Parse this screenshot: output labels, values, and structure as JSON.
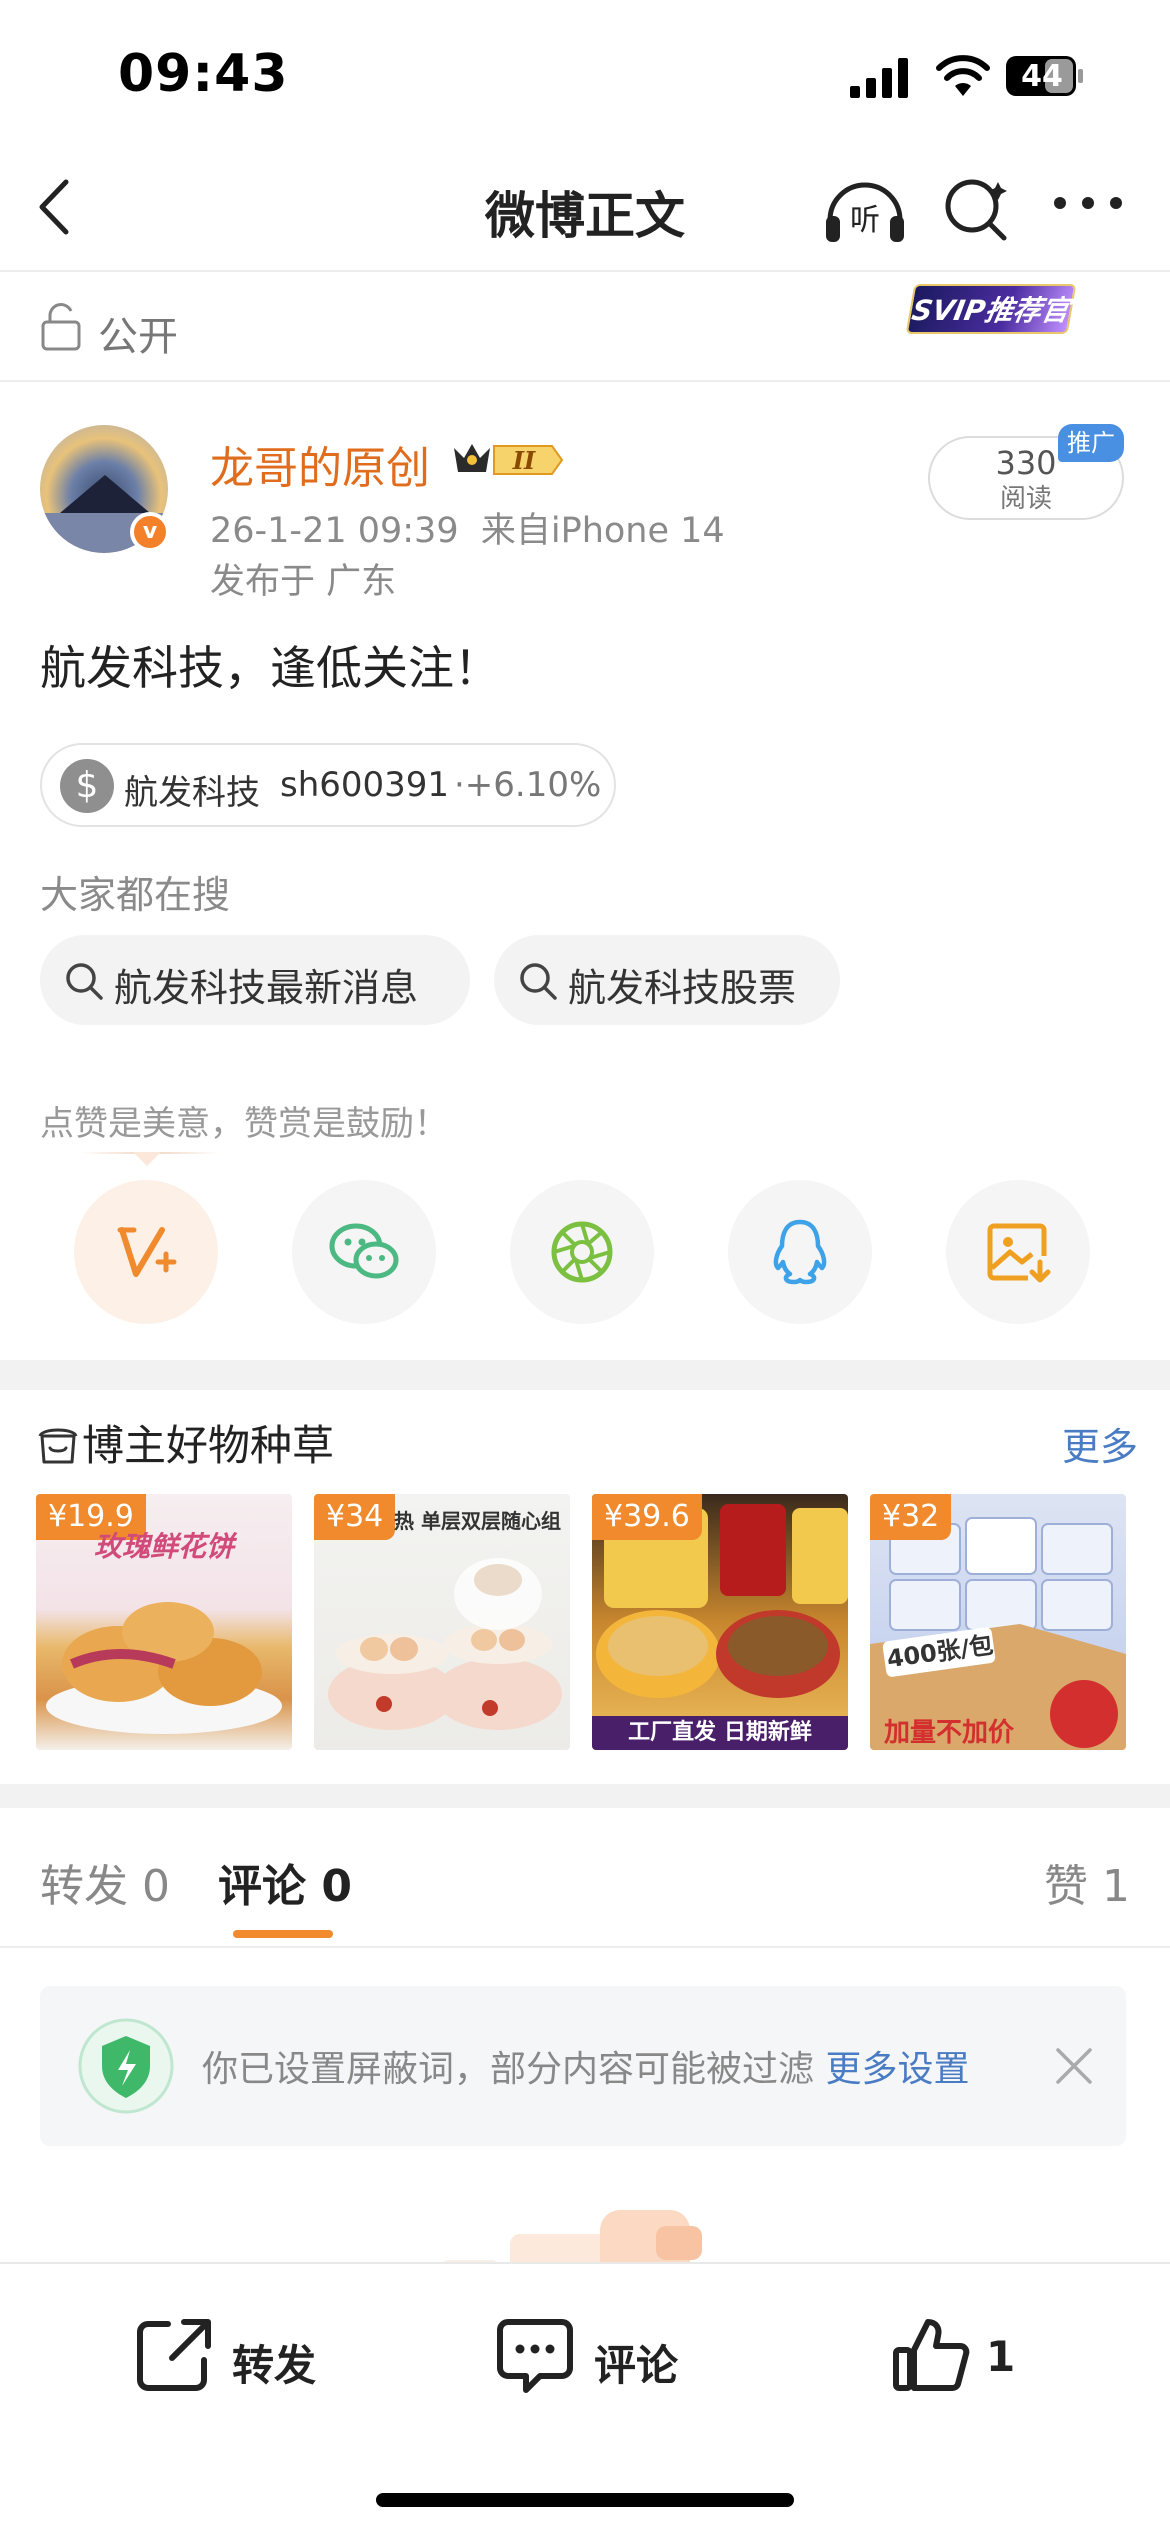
{
  "status_bar": {
    "time": "09:43",
    "battery": "44"
  },
  "nav": {
    "title": "微博正文"
  },
  "visibility": {
    "label": "公开",
    "svip_badge": "SVIP推荐官"
  },
  "post": {
    "author": "龙哥的原创",
    "level_badge": "II",
    "time": "26-1-21 09:39",
    "source": "来自iPhone 14",
    "location": "发布于 广东",
    "reads": "330",
    "reads_label": "阅读",
    "ad_tag": "推广",
    "text": "航发科技，逢低关注！",
    "stock": {
      "name": "航发科技",
      "code": "sh600391",
      "change": "·+6.10%"
    }
  },
  "searches": {
    "heading": "大家都在搜",
    "items": [
      "航发科技最新消息",
      "航发科技股票"
    ]
  },
  "praise_hint": "点赞是美意，赞赏是鼓励！",
  "share_icons": [
    "weibo-reward-icon",
    "wechat-icon",
    "moments-icon",
    "qq-icon",
    "save-image-icon"
  ],
  "goods": {
    "heading": "博主好物种草",
    "more": "更多",
    "items": [
      {
        "price": "¥19.9",
        "caption": "玫瑰鲜花饼"
      },
      {
        "price": "¥34",
        "caption": "热 单层双层随心组"
      },
      {
        "price": "¥39.6",
        "caption": "工厂直发 日期新鲜"
      },
      {
        "price": "¥32",
        "caption": "加量不加价"
      }
    ]
  },
  "tabs": {
    "repost": "转发",
    "repost_count": "0",
    "comment": "评论",
    "comment_count": "0",
    "like": "赞",
    "like_count": "1"
  },
  "notice": {
    "text": "你已设置屏蔽词，部分内容可能被过滤 ",
    "link": "更多设置"
  },
  "bottom_bar": {
    "repost": "转发",
    "comment": "评论",
    "like_count": "1"
  },
  "colors": {
    "accent": "#f08a2c",
    "author": "#e06d1e",
    "link": "#4a7cc4"
  }
}
